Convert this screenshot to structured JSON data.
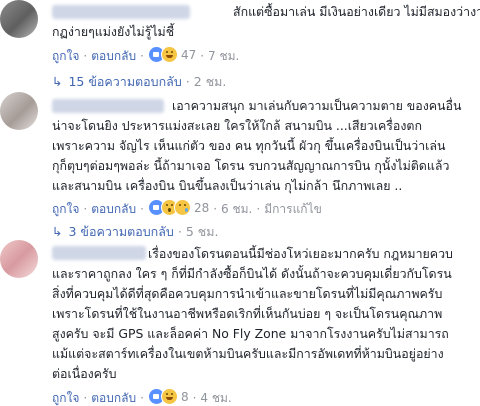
{
  "comments": [
    {
      "lines": [
        "สักแต่ซื้อมาเล่น มีเงินอย่างเดียว ไม่มีสมองว่างาน",
        "กฏง่ายๆแม่งยังไม่รู้ไม่ชี้"
      ],
      "like_label": "ถูกใจ",
      "reply_label": "ตอบกลับ",
      "reaction_count": "47",
      "timestamp": "7 ชม.",
      "replies_label": "15 ข้อความตอบกลับ",
      "replies_time": "2 ชม."
    },
    {
      "lines": [
        "เอาความสนุก มาเล่นกับความเป็นความตาย ของคนอื่น",
        "น่าจะโดนยิง ประหารแม่งสะเลย ใครให้ใกล้ สนามบิน ...เสียวเครื่องตก",
        "เพราะความ จัญไร เห็นแก่ตัว ของ คน ทุกวันนี้ ผัวกุ ขึ้นเครื่องบินเป็นว่าเล่น",
        "กุก็ตุบๆต่อมๆพอล่ะ นี้ถ้ามาเจอ โดรน รบกวนสัญญาณการบิน กุนั้งไม่ติดแล้ว",
        "และสนามบิน เครื่องบิน บินขึ้นลงเป็นว่าเล่น กุไม่กล้า นึกภาพเลย .."
      ],
      "like_label": "ถูกใจ",
      "reply_label": "ตอบกลับ",
      "reaction_count": "28",
      "timestamp": "6 ชม.",
      "edited_label": "มีการแก้ไข",
      "replies_label": "3 ข้อความตอบกลับ",
      "replies_time": "5 ชม."
    },
    {
      "lines": [
        "เรื่องของโดรนตอนนี้มีช่องโหว่เยอะมากครับ กฎหมายควบ",
        "และราคาถูกลง ใคร ๆ ก็ที่มีกำลังซื้อก็บินได้ ดังนั้นถ้าจะควบคุมเดี่ยวกับโดรน",
        "สิ่งที่ควบคุมได้ดีที่สุดคือควบคุมการนำเข้าและขายโดรนที่ไม่มีคุณภาพครับ",
        "เพราะโดรนที่ใช้ในงานอาชีพหรือดเริกที่เห็นกันบ่อย ๆ จะเป็นโดรนคุณภาพ",
        "สูงครับ จะมี GPS และล็อคค่า No Fly Zone มาจากโรงงานครับไม่สามารถ",
        "แม้แต่จะสตาร์ทเครื่องในเขตห้ามบินครับและมีการอัพเดทที่ห้ามบินอยู่อย่าง",
        "ต่อเนื่องครับ"
      ],
      "like_label": "ถูกใจ",
      "reply_label": "ตอบกลับ",
      "reaction_count": "8",
      "timestamp": "4 ชม."
    }
  ]
}
